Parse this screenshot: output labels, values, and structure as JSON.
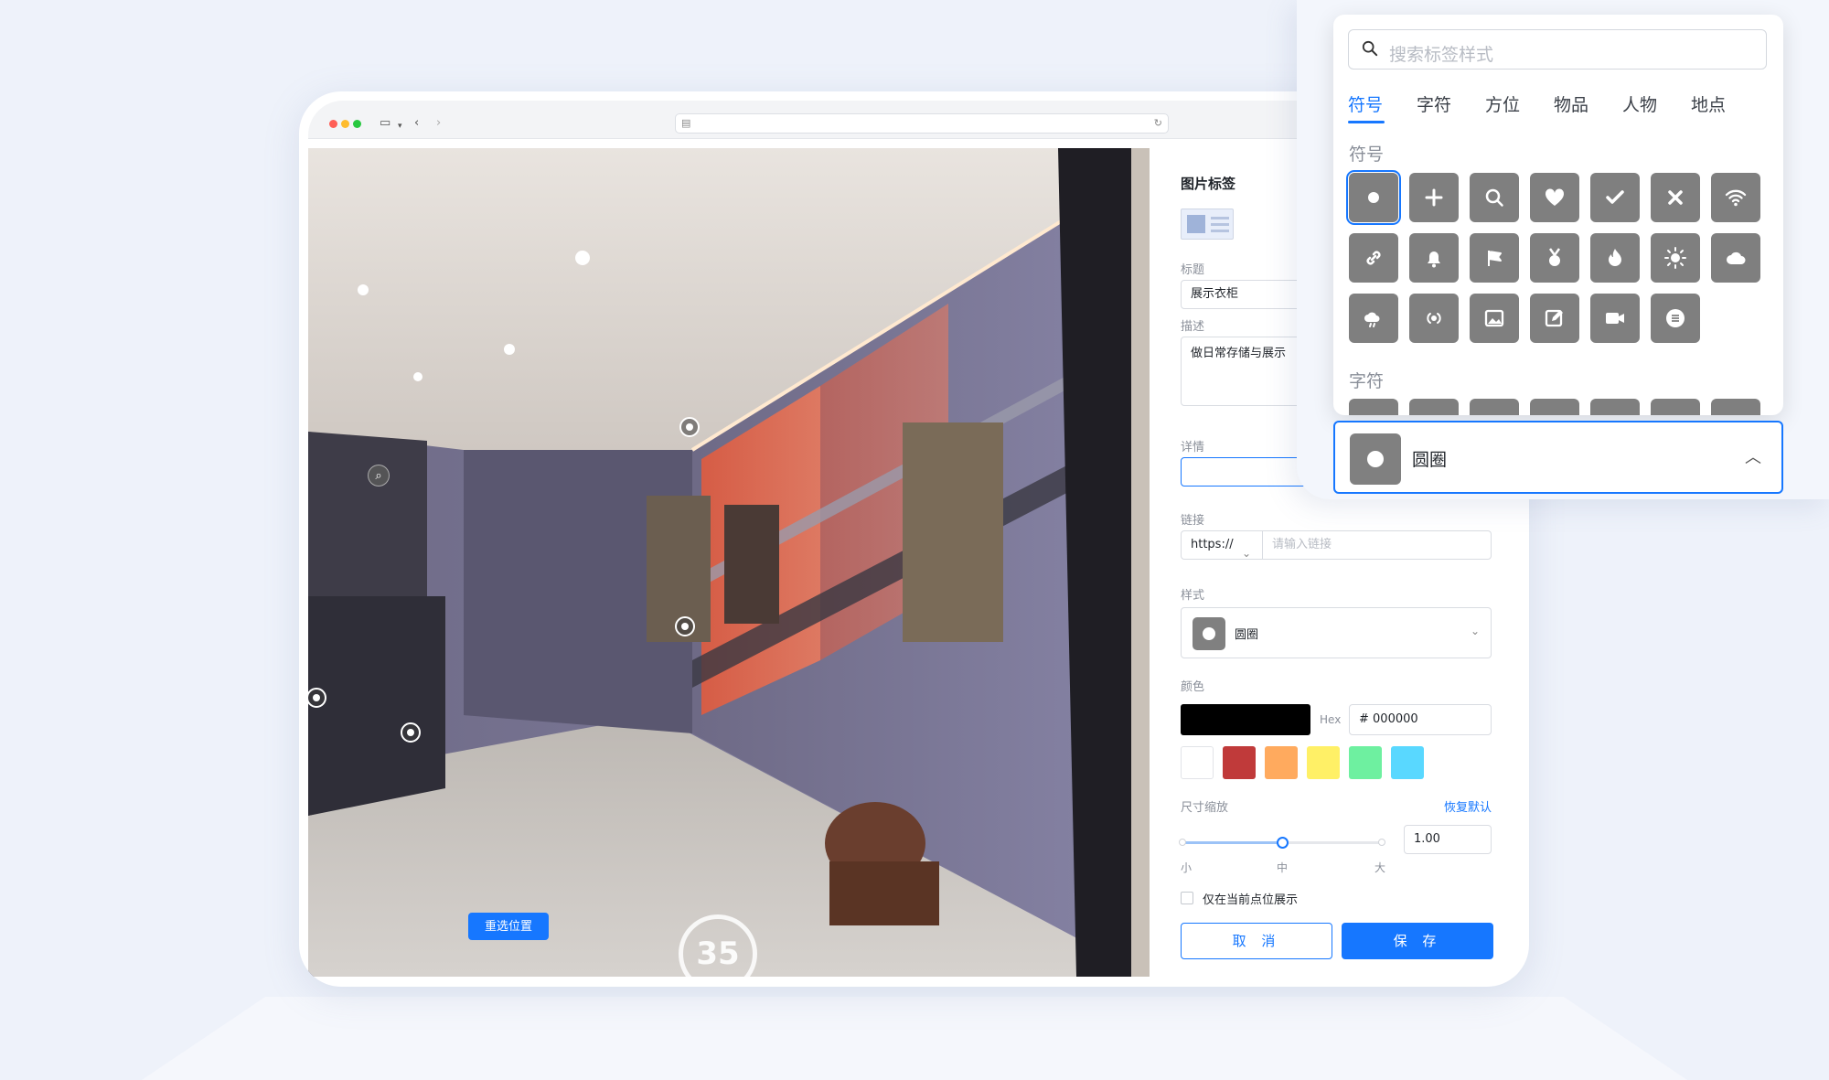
{
  "window": {
    "url_left_icon": "page-icon",
    "url_right_icon": "reload-icon"
  },
  "viewer": {
    "reselect_label": "重选位置",
    "floor_number": "35"
  },
  "panel": {
    "title": "图片标签",
    "title_label": "标题",
    "title_value": "展示衣柜",
    "desc_label": "描述",
    "desc_value": "做日常存储与展示",
    "detail_label": "详情",
    "detail_value": "",
    "link_label": "链接",
    "link_protocol": "https://",
    "link_placeholder": "请输入链接",
    "style_label": "样式",
    "style_value": "圆圈",
    "color_label": "颜色",
    "hex_label": "Hex",
    "hex_value": "# 000000",
    "main_color": "#000000",
    "swatches": [
      "#ffffff",
      "#c03a3a",
      "#ffaa5e",
      "#fff066",
      "#6ef0a0",
      "#59d8ff"
    ],
    "scale_label": "尺寸缩放",
    "reset_label": "恢复默认",
    "scale_min": "小",
    "scale_mid": "中",
    "scale_max": "大",
    "scale_value": "1.00",
    "scale_fraction": 0.5,
    "only_current_label": "仅在当前点位展示",
    "cancel_label": "取 消",
    "save_label": "保 存"
  },
  "popup": {
    "search_placeholder": "搜索标签样式",
    "tabs": [
      "符号",
      "字符",
      "方位",
      "物品",
      "人物",
      "地点"
    ],
    "active_tab": "符号",
    "section_symbols": "符号",
    "section_chars": "字符",
    "icons": [
      "circle-icon",
      "plus-icon",
      "search-icon",
      "heart-icon",
      "check-icon",
      "close-icon",
      "wifi-icon",
      "link-icon",
      "bell-icon",
      "flag-icon",
      "medal-icon",
      "fire-icon",
      "sun-icon",
      "cloud-icon",
      "cloud-sun-icon",
      "audio-icon",
      "image-icon",
      "edit-icon",
      "video-icon",
      "list-icon"
    ],
    "selected_label": "圆圈"
  }
}
